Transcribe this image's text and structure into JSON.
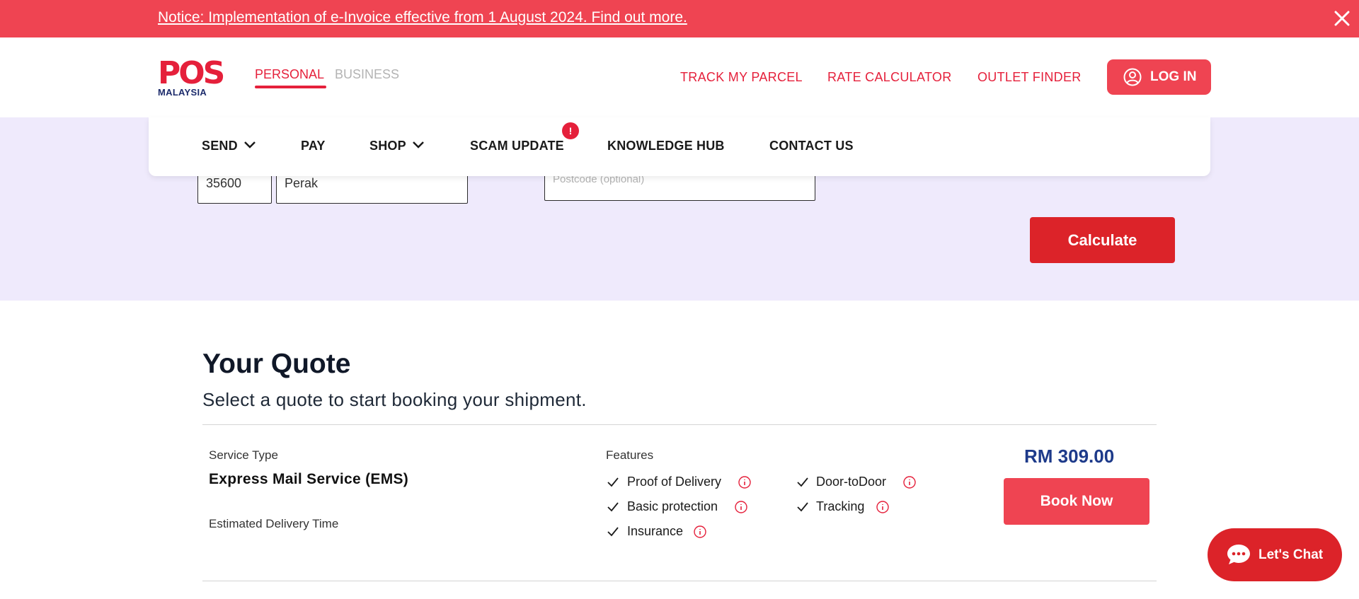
{
  "notice": {
    "text": "Notice: Implementation of e-Invoice effective from 1 August 2024. Find out more."
  },
  "brand": {
    "logo_text": "POS",
    "sub": "MALAYSIA",
    "color": "#e5203b",
    "navy": "#1d2c6c"
  },
  "segments": {
    "personal": "PERSONAL",
    "business": "BUSINESS"
  },
  "top_links": {
    "track": "TRACK MY PARCEL",
    "rate": "RATE CALCULATOR",
    "outlet": "OUTLET FINDER"
  },
  "login": {
    "label": "LOG IN"
  },
  "nav": {
    "send": "SEND",
    "pay": "PAY",
    "shop": "SHOP",
    "scam": "SCAM UPDATE",
    "scam_badge": "!",
    "knowledge": "KNOWLEDGE HUB",
    "contact": "CONTACT US"
  },
  "form": {
    "postcode_value": "35600",
    "state_value": "Perak",
    "optional_placeholder": "Postcode (optional)",
    "calculate_label": "Calculate"
  },
  "quote": {
    "title": "Your Quote",
    "subtitle": "Select a quote to start booking your shipment.",
    "service_type_label": "Service Type",
    "service_name": "Express Mail Service (EMS)",
    "delivery_time_label": "Estimated Delivery Time",
    "features_label": "Features",
    "features": {
      "proof": "Proof of Delivery",
      "basic": "Basic protection",
      "insurance": "Insurance",
      "door": "Door-toDoor",
      "tracking": "Tracking"
    },
    "price": "RM 309.00",
    "book_label": "Book Now"
  },
  "chat": {
    "label": "Let's Chat"
  },
  "colors": {
    "notice_bg": "#ef4452",
    "form_bg": "#efeafc",
    "calc": "#dc2329",
    "price": "#1d3a8a"
  }
}
